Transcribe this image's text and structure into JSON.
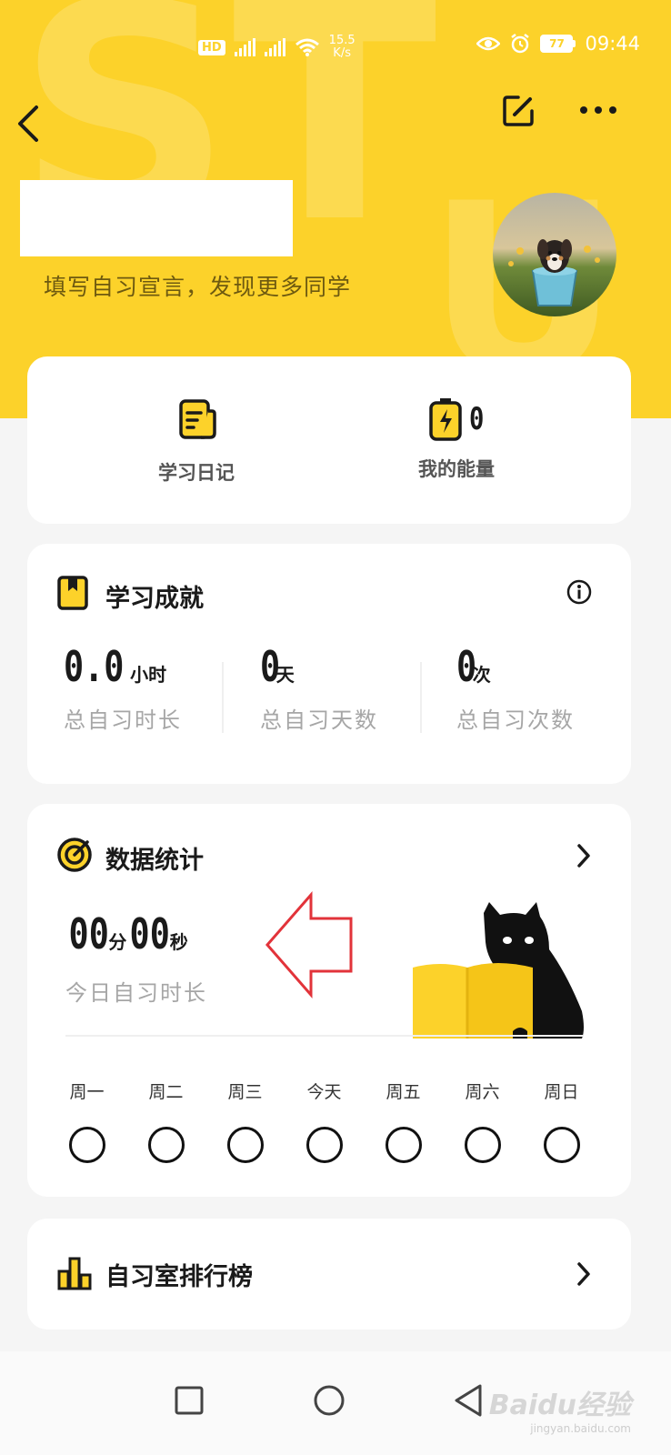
{
  "status_bar": {
    "hd_label": "HD",
    "net_1": "4G",
    "net_2": "4G",
    "speed_value": "15.5",
    "speed_unit": "K/s",
    "battery": "77",
    "time": "09:44"
  },
  "header": {
    "manifesto_placeholder": "填写自习宣言，发现更多同学",
    "bg_color": "#fcd22a"
  },
  "shortcuts": {
    "diary_label": "学习日记",
    "energy_label": "我的能量",
    "energy_count": "0"
  },
  "achievements": {
    "title": "学习成就",
    "stats": [
      {
        "value": "0.0",
        "unit": "小时",
        "label": "总自习时长"
      },
      {
        "value": "0",
        "unit": "天",
        "label": "总自习天数"
      },
      {
        "value": "0",
        "unit": "次",
        "label": "总自习次数"
      }
    ]
  },
  "statistics": {
    "title": "数据统计",
    "minutes": "00",
    "minutes_unit": "分",
    "seconds": "00",
    "seconds_unit": "秒",
    "today_label": "今日自习时长",
    "days": [
      "周一",
      "周二",
      "周三",
      "今天",
      "周五",
      "周六",
      "周日"
    ]
  },
  "leaderboard": {
    "title": "自习室排行榜"
  },
  "watermark": {
    "brand": "Baidu经验",
    "url": "jingyan.baidu.com"
  }
}
